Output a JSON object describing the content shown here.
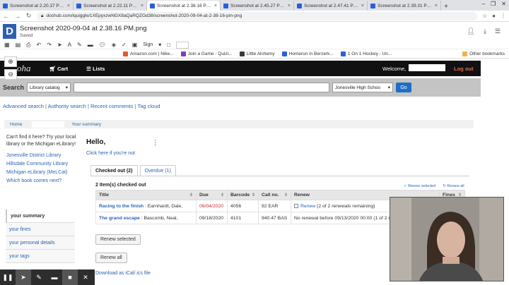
{
  "browser": {
    "tabs": [
      {
        "label": "Screenshot at 2.20.37 PM.pn",
        "active": false
      },
      {
        "label": "Screenshot at 2.22.11 PM.pn",
        "active": false
      },
      {
        "label": "Screenshot at 2.38.16 PM.pn",
        "active": true
      },
      {
        "label": "Screenshot at 2.45.27 PM.pn",
        "active": false
      },
      {
        "label": "Screenshot at 2.47.41 PM.pn",
        "active": false
      },
      {
        "label": "Screenshot at 2.39.31 PM.pn",
        "active": false
      }
    ],
    "new_tab": "+",
    "url": "dochub.com/iquiggle/1XEpyxzwNGX8aQaRQZGd38/screenshot-2020-09-04-at-2-38-16-pm-png"
  },
  "doc": {
    "logo": "D",
    "filename": "Screenshot 2020-09-04 at 2.38.16 PM.png",
    "status": "Saved",
    "sign_label": "Sign"
  },
  "bookmarks": [
    {
      "label": "Amazon.com | Nike..."
    },
    {
      "label": "Join a Game - Quizi..."
    },
    {
      "label": "Little Alchemy"
    },
    {
      "label": "Homerun in Berzerk..."
    },
    {
      "label": "1 On 1 Hockey - Un..."
    },
    {
      "label": "Other bookmarks"
    }
  ],
  "koha": {
    "logo": "oha",
    "cart": "Cart",
    "lists": "Lists",
    "welcome": "Welcome,",
    "logout": "Log out",
    "search_label": "Search",
    "search_type": "Library catalog",
    "search_value": "",
    "library": "Jonesville High Schoo",
    "go": "Go",
    "links": [
      "Advanced search",
      "Authority search",
      "Recent comments",
      "Tag cloud"
    ],
    "breadcrumb_home": "Home",
    "breadcrumb_current": "Your summary"
  },
  "left": {
    "intro": "Can't find it here? Try your local library or the Michigan eLibrary!",
    "library_links": [
      "Jonesville District Library",
      "Hillsdale Community Library",
      "Michigan eLibrary (MeLCat)",
      "Which book comes next?"
    ],
    "nav": [
      "your summary",
      "your fines",
      "your personal details",
      "your tags"
    ]
  },
  "main": {
    "hello": "Hello,",
    "not_you": "Click here if you're not",
    "tabs": [
      "Checked out (2)",
      "Overdue (1)"
    ],
    "items_line": "2 Item(s) checked out",
    "renew_selected_link": "Renew selected",
    "renew_all_link": "Renew all",
    "columns": [
      "Title",
      "Due",
      "Barcode",
      "Call no.",
      "Renew",
      "Fines"
    ],
    "rows": [
      {
        "title": "Racing to the finish",
        "author": " : Earnhardt, Dale,",
        "due": "06/04/2020",
        "barcode": "4056",
        "callno": "92 EAR",
        "renew": "Renew",
        "renew_note": " (2 of 2 renewals remaining)",
        "overdue": true
      },
      {
        "title": "The grand escape",
        "author": " : Bascomb, Neal,",
        "due": "09/18/2020",
        "barcode": "4101",
        "callno": "940.47 BAS",
        "renew": "",
        "renew_note": "No renewal before 09/13/2020 00:00 (1 of 2 r",
        "overdue": false
      }
    ],
    "renew_selected_btn": "Renew selected",
    "renew_all_btn": "Renew all",
    "download": "Download as iCal/.ics file"
  }
}
